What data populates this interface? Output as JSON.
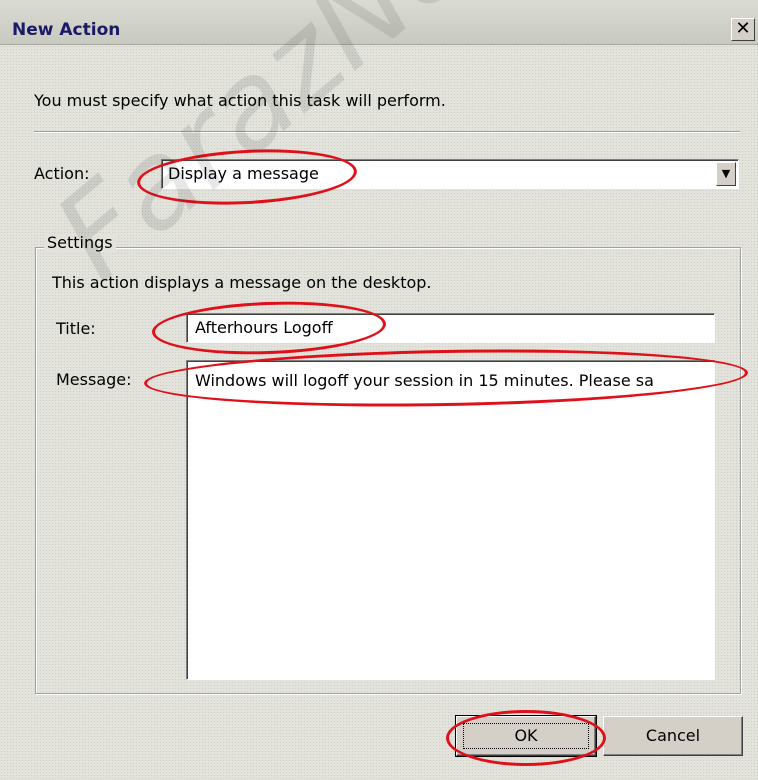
{
  "window": {
    "title": "New Action",
    "close_label": "✕"
  },
  "instruction": "You must specify what action this task will perform.",
  "action": {
    "label": "Action:",
    "value": "Display a message"
  },
  "settings": {
    "legend": "Settings",
    "description": "This action displays a message on the desktop.",
    "title_label": "Title:",
    "title_value": "Afterhours Logoff",
    "message_label": "Message:",
    "message_value": "Windows will logoff your session in 15 minutes. Please sa"
  },
  "buttons": {
    "ok": "OK",
    "cancel": "Cancel"
  },
  "watermark": "FarazNe",
  "colors": {
    "annotation": "#e0101a",
    "dialog_bg": "#e3e3dc",
    "title_text": "#1a1a66"
  }
}
